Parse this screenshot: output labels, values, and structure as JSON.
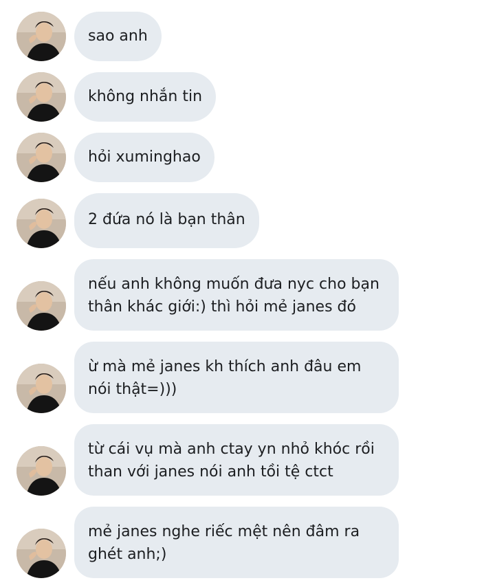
{
  "conversation": {
    "messages": [
      {
        "text": "sao anh"
      },
      {
        "text": "không nhắn tin"
      },
      {
        "text": "hỏi xuminghao"
      },
      {
        "text": "2 đứa nó là bạn thân"
      },
      {
        "text": "nếu anh không muốn đưa nyc cho bạn thân khác giới:) thì hỏi mẻ janes đó"
      },
      {
        "text": "ừ mà mẻ janes kh thích anh đâu em nói thật=)))"
      },
      {
        "text": "từ cái vụ mà anh ctay yn nhỏ khóc rồi than với janes nói anh tồi tệ ctct"
      },
      {
        "text": "mẻ janes nghe riếc mệt nên đâm ra ghét anh;)"
      }
    ]
  },
  "colors": {
    "bubble_bg": "#e6ebf0",
    "text": "#1c1e21",
    "page_bg": "#ffffff"
  },
  "icons": {
    "avatar": "profile-photo-avatar"
  }
}
